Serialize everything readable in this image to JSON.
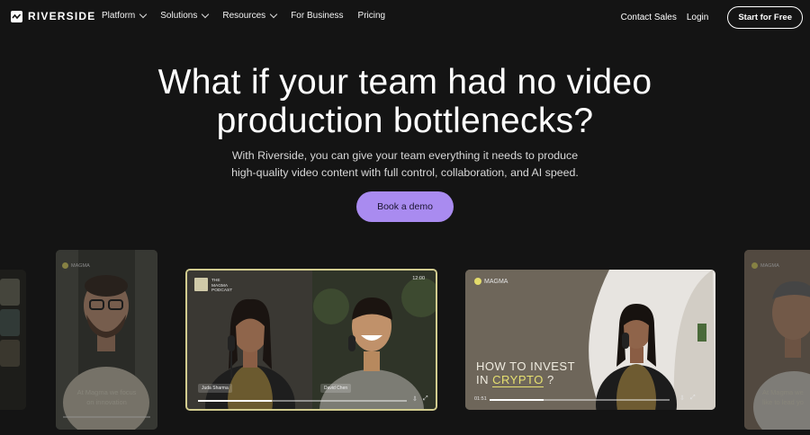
{
  "brand": {
    "name": "RIVERSIDE"
  },
  "nav": {
    "items": [
      {
        "label": "Platform",
        "has_dropdown": true
      },
      {
        "label": "Solutions",
        "has_dropdown": true
      },
      {
        "label": "Resources",
        "has_dropdown": true
      },
      {
        "label": "For Business",
        "has_dropdown": false
      },
      {
        "label": "Pricing",
        "has_dropdown": false
      }
    ],
    "contact": "Contact Sales",
    "login": "Login",
    "start": "Start for Free"
  },
  "hero": {
    "headline_line1": "What if your team had no video",
    "headline_line2": "production bottlenecks?",
    "sub_line1": "With Riverside, you can give your team everything it needs to produce",
    "sub_line2": "high-quality video content with full control, collaboration, and AI speed.",
    "cta": "Book a demo"
  },
  "cards": {
    "p1": {
      "brand": "MAGMA",
      "caption1": "At Magma we focus",
      "caption2": "on innovation"
    },
    "main": {
      "brand_line1": "THE",
      "brand_line2": "MAGMA",
      "brand_line3": "PODCAST",
      "time": "12:00",
      "guest1": "Juda Sharma",
      "guest2": "David Chen"
    },
    "crypto": {
      "brand": "MAGMA",
      "title_line1": "HOW TO INVEST",
      "title_prefix": "IN",
      "title_highlight": "CRYPTO",
      "title_suffix": "?",
      "time": "01:51"
    },
    "right": {
      "brand": "MAGMA",
      "caption1": "At Magma we",
      "caption2": "like to lead yo"
    }
  },
  "colors": {
    "background": "#141414",
    "cta": "#a98bf0",
    "highlight_border": "#d2cc8f",
    "crypto_highlight": "#e6e070"
  }
}
